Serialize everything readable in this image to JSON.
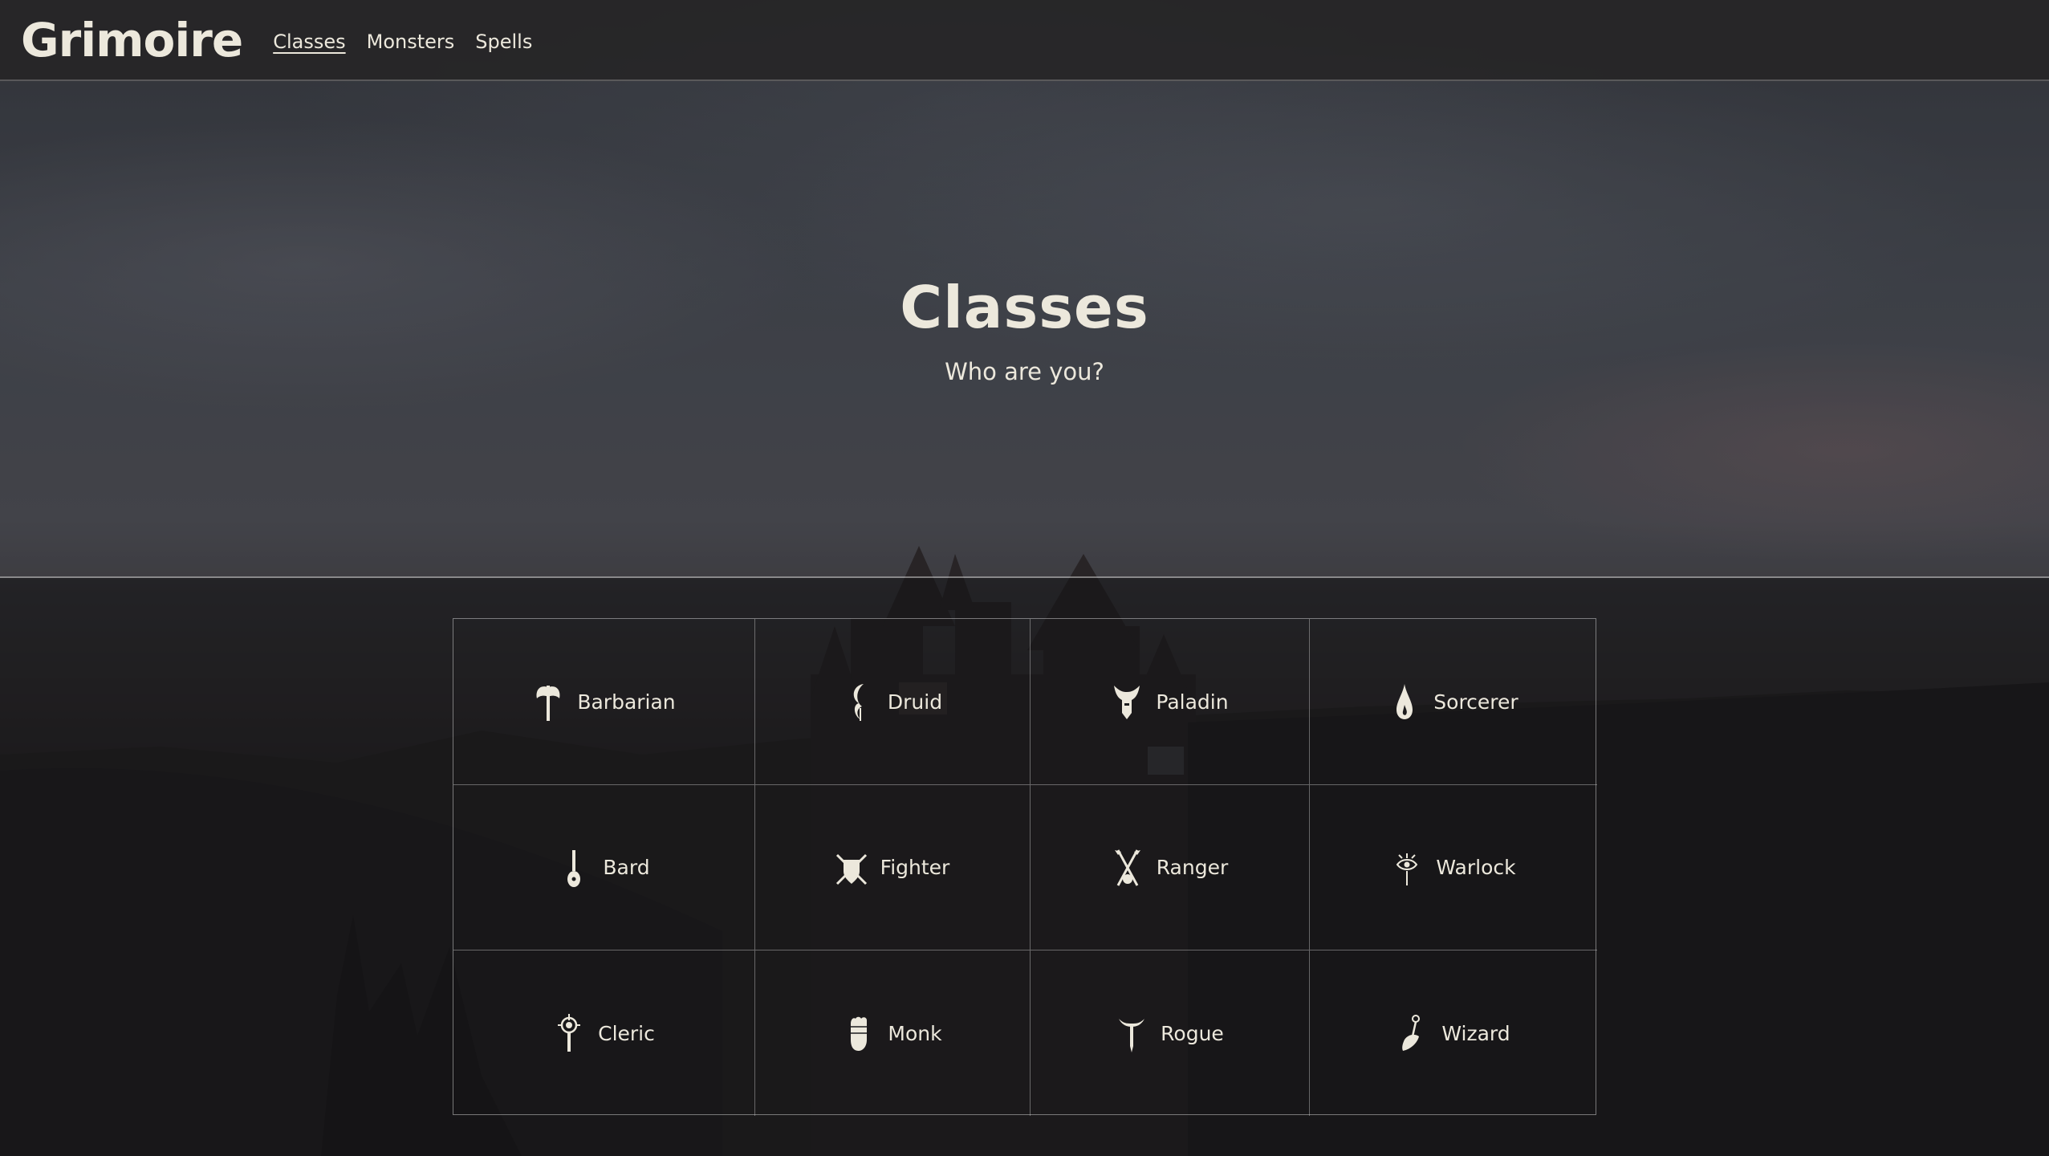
{
  "brand": "Grimoire",
  "nav": {
    "items": [
      {
        "label": "Classes",
        "active": true
      },
      {
        "label": "Monsters",
        "active": false
      },
      {
        "label": "Spells",
        "active": false
      }
    ]
  },
  "hero": {
    "title": "Classes",
    "subtitle": "Who are you?"
  },
  "classes": [
    {
      "label": "Barbarian",
      "icon": "axe-icon"
    },
    {
      "label": "Druid",
      "icon": "crescent-sprout-icon"
    },
    {
      "label": "Paladin",
      "icon": "winged-helm-icon"
    },
    {
      "label": "Sorcerer",
      "icon": "flame-drop-icon"
    },
    {
      "label": "Bard",
      "icon": "lute-icon"
    },
    {
      "label": "Fighter",
      "icon": "crossed-swords-shield-icon"
    },
    {
      "label": "Ranger",
      "icon": "crossed-arrows-icon"
    },
    {
      "label": "Warlock",
      "icon": "eye-sigil-icon"
    },
    {
      "label": "Cleric",
      "icon": "holy-symbol-icon"
    },
    {
      "label": "Monk",
      "icon": "fist-icon"
    },
    {
      "label": "Rogue",
      "icon": "dagger-icon"
    },
    {
      "label": "Wizard",
      "icon": "staff-hand-icon"
    }
  ],
  "colors": {
    "text": "#ece8dc",
    "navbar": "#262426",
    "grid_border": "#c8c8c8"
  }
}
